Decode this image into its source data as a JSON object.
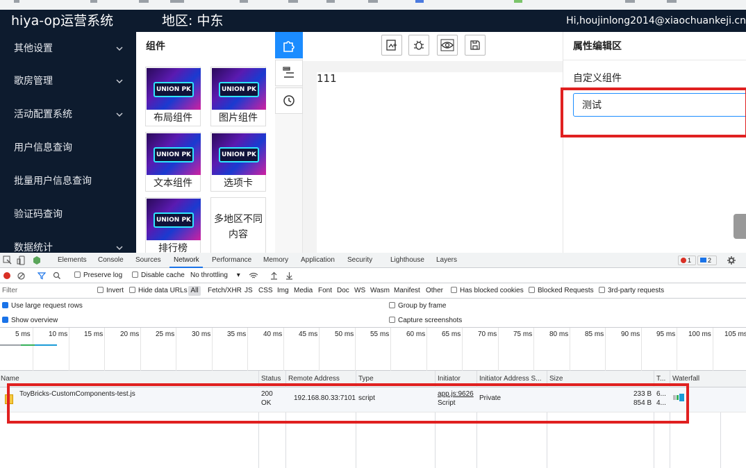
{
  "header": {
    "app_title": "hiya-op运营系统",
    "region": "地区: 中东",
    "user": "Hi,houjinlong2014@xiaochuankeji.cn"
  },
  "sidebar": {
    "items": [
      {
        "label": "其他设置",
        "has_chevron": true
      },
      {
        "label": "歌房管理",
        "has_chevron": true
      },
      {
        "label": "活动配置系统",
        "has_chevron": true
      },
      {
        "label": "用户信息查询",
        "has_chevron": false
      },
      {
        "label": "批量用户信息查询",
        "has_chevron": false
      },
      {
        "label": "验证码查询",
        "has_chevron": false
      },
      {
        "label": "数据统计",
        "has_chevron": true
      }
    ]
  },
  "components": {
    "title": "组件",
    "thumb_text": "UNION PK",
    "items": [
      {
        "label": "布局组件",
        "thumb": true
      },
      {
        "label": "图片组件",
        "thumb": true
      },
      {
        "label": "文本组件",
        "thumb": true
      },
      {
        "label": "选项卡",
        "thumb": true
      },
      {
        "label": "排行榜",
        "thumb": true
      },
      {
        "label": "多地区不同内容",
        "thumb": false
      }
    ]
  },
  "tool_column": {
    "icons": [
      "puzzle-icon",
      "outline-icon",
      "history-icon"
    ]
  },
  "toolbar": {
    "icons": [
      "image-add-icon",
      "bug-icon",
      "preview-icon",
      "save-icon"
    ]
  },
  "canvas": {
    "text": "111"
  },
  "properties": {
    "title": "属性编辑区",
    "custom_label": "自定义组件",
    "custom_value": "测试"
  },
  "devtools": {
    "tabs": [
      "Elements",
      "Console",
      "Sources",
      "Network",
      "Performance",
      "Memory",
      "Application",
      "Security",
      "Lighthouse",
      "Layers"
    ],
    "active_tab": "Network",
    "error_count": "1",
    "message_count": "2",
    "toolbar": {
      "preserve_log": "Preserve log",
      "disable_cache": "Disable cache",
      "throttling": "No throttling"
    },
    "filter": {
      "placeholder": "Filter",
      "invert": "Invert",
      "hide_data_urls": "Hide data URLs",
      "types": [
        "All",
        "Fetch/XHR",
        "JS",
        "CSS",
        "Img",
        "Media",
        "Font",
        "Doc",
        "WS",
        "Wasm",
        "Manifest",
        "Other"
      ],
      "blocked_cookies": "Has blocked cookies",
      "blocked_requests": "Blocked Requests",
      "third_party": "3rd-party requests"
    },
    "options": {
      "large_rows": "Use large request rows",
      "show_overview": "Show overview",
      "group_by_frame": "Group by frame",
      "capture_screenshots": "Capture screenshots"
    },
    "timeline_ticks": [
      "5 ms",
      "10 ms",
      "15 ms",
      "20 ms",
      "25 ms",
      "30 ms",
      "35 ms",
      "40 ms",
      "45 ms",
      "50 ms",
      "55 ms",
      "60 ms",
      "65 ms",
      "70 ms",
      "75 ms",
      "80 ms",
      "85 ms",
      "90 ms",
      "95 ms",
      "100 ms",
      "105 ms"
    ],
    "columns": [
      "Name",
      "Status",
      "Remote Address",
      "Type",
      "Initiator",
      "Initiator Address S...",
      "Size",
      "T...",
      "Waterfall"
    ],
    "rows": [
      {
        "name": "ToyBricks-CustomComponents-test.js",
        "status": "200",
        "status_text": "OK",
        "remote": "192.168.80.33:7101",
        "type": "script",
        "initiator": "app.js:9626",
        "initiator_type": "Script",
        "initiator_space": "Private",
        "size1": "233 B",
        "size2": "854 B",
        "time1": "6...",
        "time2": "4..."
      }
    ]
  },
  "colors": {
    "sidebar_bg": "#0d1b2e",
    "accent": "#1b8cff",
    "highlight_red": "#e02020"
  }
}
